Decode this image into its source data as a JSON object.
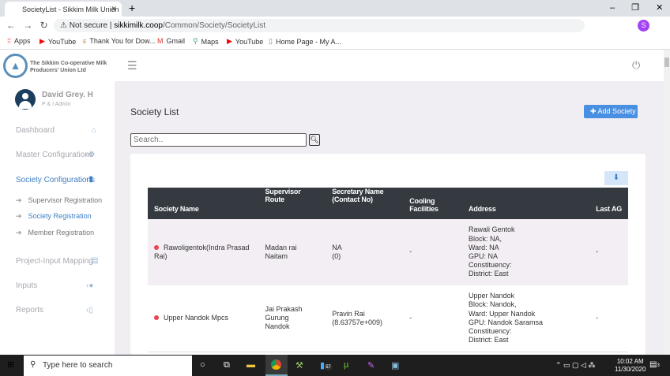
{
  "browser": {
    "tab_title": "SocietyList - Sikkim Milk Union",
    "security": "Not secure",
    "url_host": "sikkimilk.coop",
    "url_path": "/Common/Society/SocietyList",
    "profile_initial": "S",
    "bookmarks": [
      "Apps",
      "YouTube",
      "Thank You for Dow...",
      "Gmail",
      "Maps",
      "YouTube",
      "Home Page - My A..."
    ]
  },
  "brand": {
    "name_line1": "The Sikkim Co-operative Milk",
    "name_line2": "Producers' Union Ltd"
  },
  "user": {
    "name": "David Grey. H",
    "role": "P & I Admin"
  },
  "sidebar": {
    "items": [
      {
        "label": "Dashboard"
      },
      {
        "label": "Master Configurations"
      },
      {
        "label": "Society Configurations"
      },
      {
        "label": "Project-Input Mapping"
      },
      {
        "label": "Inputs"
      },
      {
        "label": "Reports"
      }
    ],
    "sub_items": [
      {
        "label": "Supervisor Registration"
      },
      {
        "label": "Society Registration"
      },
      {
        "label": "Member Registration"
      }
    ]
  },
  "page": {
    "title": "Society List",
    "add_button": "Add Society",
    "search_placeholder": "Search.."
  },
  "table": {
    "headers": [
      "Society Name",
      "Supervisor Route",
      "Secretary Name (Contact No)",
      "Cooling Facilities",
      "Address",
      "Last AG"
    ],
    "header_lines": {
      "supervisor": [
        "Supervisor",
        "Route"
      ],
      "secretary": [
        "Secretary Name",
        "(Contact No)"
      ]
    },
    "rows": [
      {
        "name": "Rawoligentok(Indra Prasad Rai)",
        "supervisor": [
          "Madan rai",
          "Naitam"
        ],
        "secretary": [
          "NA",
          "(0)"
        ],
        "cooling": "-",
        "address": [
          "Rawali Gentok",
          "Block: NA,",
          "Ward: NA",
          "GPU: NA",
          "Constituency:",
          "District: East"
        ],
        "last_agm": "-"
      },
      {
        "name": "Upper Nandok Mpcs",
        "supervisor": [
          "Jai Prakash Gurung",
          "Nandok"
        ],
        "secretary": [
          "Pravin Rai",
          "(8.63757e+009)"
        ],
        "cooling": "-",
        "address": [
          "Upper Nandok",
          "Block: Nandok,",
          "Ward: Upper Nandok",
          "GPU: Nandok Saramsa",
          "Constituency:",
          "District: East"
        ],
        "last_agm": "-"
      }
    ]
  },
  "taskbar": {
    "search_placeholder": "Type here to search",
    "time": "10:02 AM",
    "date": "11/30/2020",
    "badge": "57",
    "notif": "3"
  },
  "colors": {
    "accent": "#4a90e2",
    "header": "#343a40",
    "dot": "#e8474f"
  }
}
